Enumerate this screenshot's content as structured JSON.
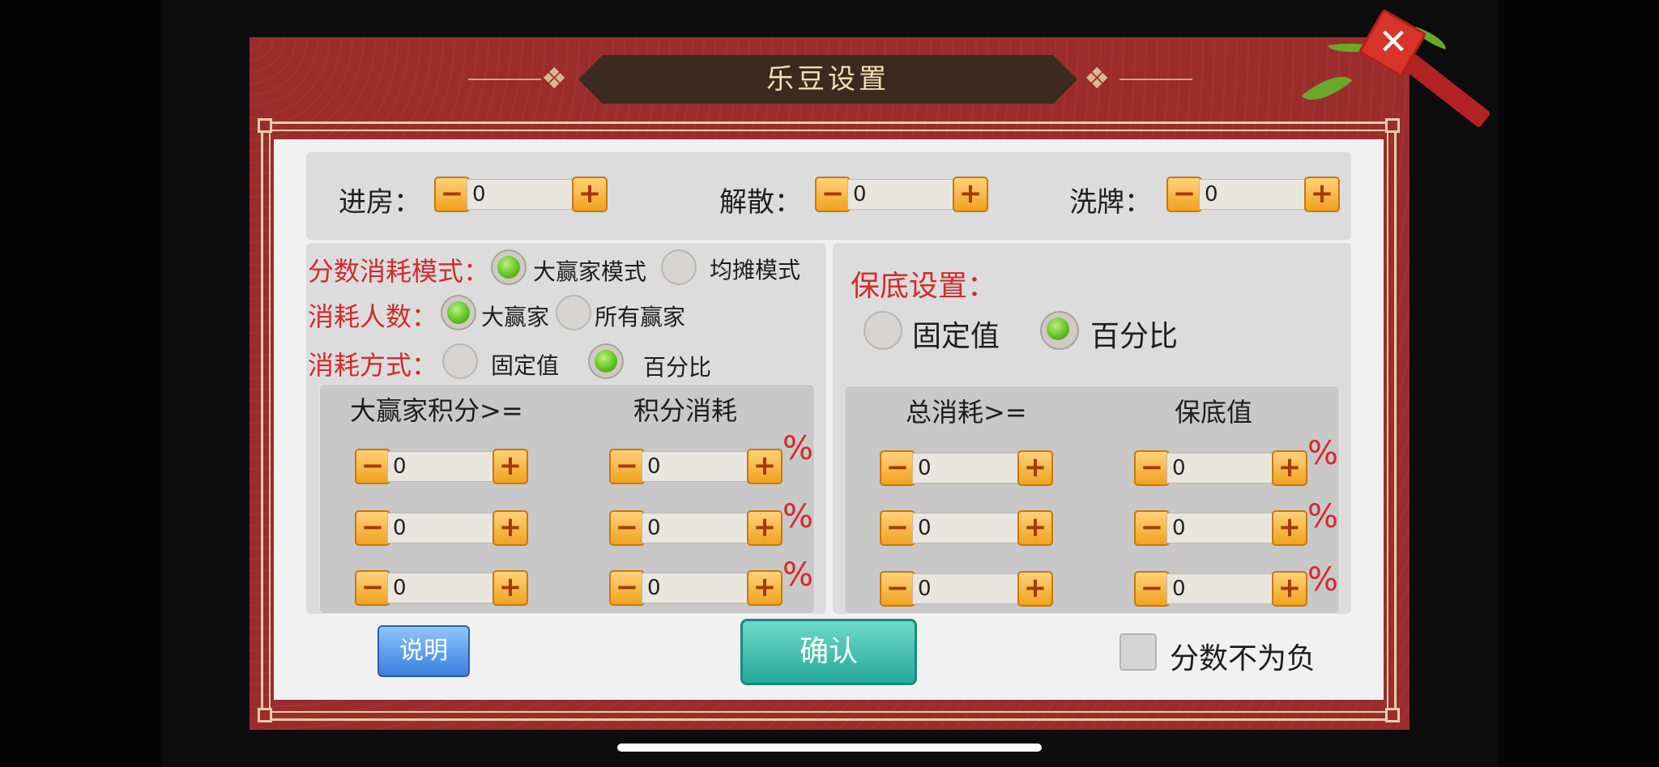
{
  "dialog": {
    "title": "乐豆设置",
    "close_glyph": "✕"
  },
  "top_row": [
    {
      "label": "进房：",
      "value": "0"
    },
    {
      "label": "解散：",
      "value": "0"
    },
    {
      "label": "洗牌：",
      "value": "0"
    }
  ],
  "stepper_glyphs": {
    "minus": "−",
    "plus": "+"
  },
  "left_section": {
    "score_mode": {
      "label": "分数消耗模式：",
      "options": [
        {
          "label": "大赢家模式",
          "selected": true
        },
        {
          "label": "均摊模式",
          "selected": false
        }
      ]
    },
    "consumer_count": {
      "label": "消耗人数：",
      "options": [
        {
          "label": "大赢家",
          "selected": true
        },
        {
          "label": "所有赢家",
          "selected": false
        }
      ]
    },
    "consume_method": {
      "label": "消耗方式：",
      "options": [
        {
          "label": "固定值",
          "selected": false
        },
        {
          "label": "百分比",
          "selected": true
        }
      ]
    },
    "table": {
      "col1_header": "大赢家积分>=",
      "col2_header": "积分消耗",
      "rows": [
        {
          "threshold": "0",
          "consume": "0",
          "unit": "%"
        },
        {
          "threshold": "0",
          "consume": "0",
          "unit": "%"
        },
        {
          "threshold": "0",
          "consume": "0",
          "unit": "%"
        }
      ]
    }
  },
  "right_section": {
    "title": "保底设置：",
    "options": [
      {
        "label": "固定值",
        "selected": false
      },
      {
        "label": "百分比",
        "selected": true
      }
    ],
    "table": {
      "col1_header": "总消耗>=",
      "col2_header": "保底值",
      "rows": [
        {
          "threshold": "0",
          "value": "0",
          "unit": "%"
        },
        {
          "threshold": "0",
          "value": "0",
          "unit": "%"
        },
        {
          "threshold": "0",
          "value": "0",
          "unit": "%"
        }
      ]
    }
  },
  "footer": {
    "help_label": "说明",
    "confirm_label": "确认",
    "nonnegative_label": "分数不为负",
    "nonnegative_checked": false
  },
  "colors": {
    "frame": "#9b2c2c",
    "accent_red": "#d22b2b",
    "confirm": "#27a99a",
    "help": "#3a7fdc"
  }
}
